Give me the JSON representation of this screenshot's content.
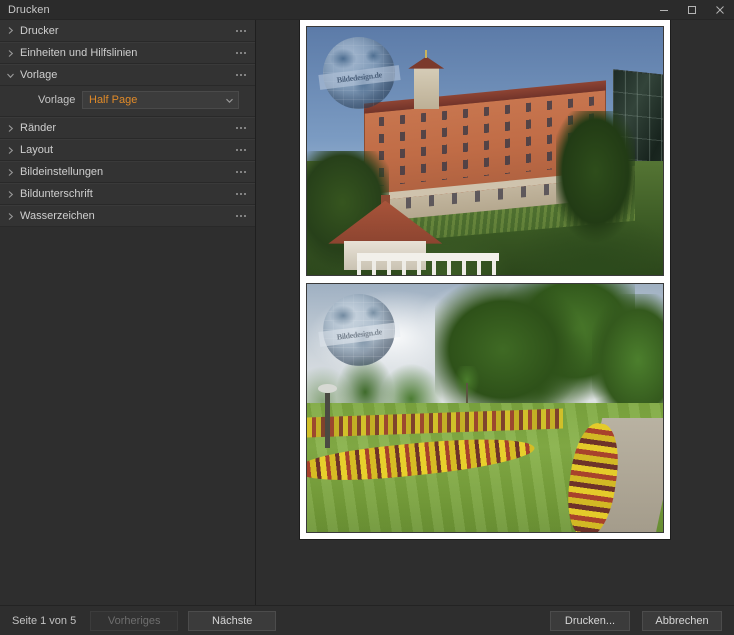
{
  "window": {
    "title": "Drucken",
    "controls": {
      "minimize": "minimize-icon",
      "maximize": "maximize-icon",
      "close": "close-icon"
    }
  },
  "sidebar": {
    "sections": [
      {
        "label": "Drucker",
        "expanded": false,
        "menu": "overflow-menu-icon"
      },
      {
        "label": "Einheiten und Hilfslinien",
        "expanded": false,
        "menu": "overflow-menu-icon"
      },
      {
        "label": "Vorlage",
        "expanded": true,
        "menu": "overflow-menu-icon"
      },
      {
        "label": "Ränder",
        "expanded": false,
        "menu": "overflow-menu-icon"
      },
      {
        "label": "Layout",
        "expanded": false,
        "menu": "overflow-menu-icon"
      },
      {
        "label": "Bildeinstellungen",
        "expanded": false,
        "menu": "overflow-menu-icon"
      },
      {
        "label": "Bildunterschrift",
        "expanded": false,
        "menu": "overflow-menu-icon"
      },
      {
        "label": "Wasserzeichen",
        "expanded": false,
        "menu": "overflow-menu-icon"
      }
    ],
    "vorlage_section": {
      "field_label": "Vorlage",
      "selected_value": "Half Page",
      "value_color": "#e08a28",
      "dropdown_icon": "chevron-down-icon"
    }
  },
  "preview": {
    "photos": [
      {
        "alt": "Historisches Gebaeude auf dem Huegel",
        "watermark_text": "Bildedesign.de"
      },
      {
        "alt": "Parkanlage mit Blumenbeeten",
        "watermark_text": "Bildedesign.de"
      }
    ]
  },
  "statusbar": {
    "page_label": "Seite 1 von 5",
    "previous_button": "Vorheriges",
    "previous_enabled": false,
    "next_button": "Nächste",
    "print_button": "Drucken...",
    "cancel_button": "Abbrechen"
  }
}
